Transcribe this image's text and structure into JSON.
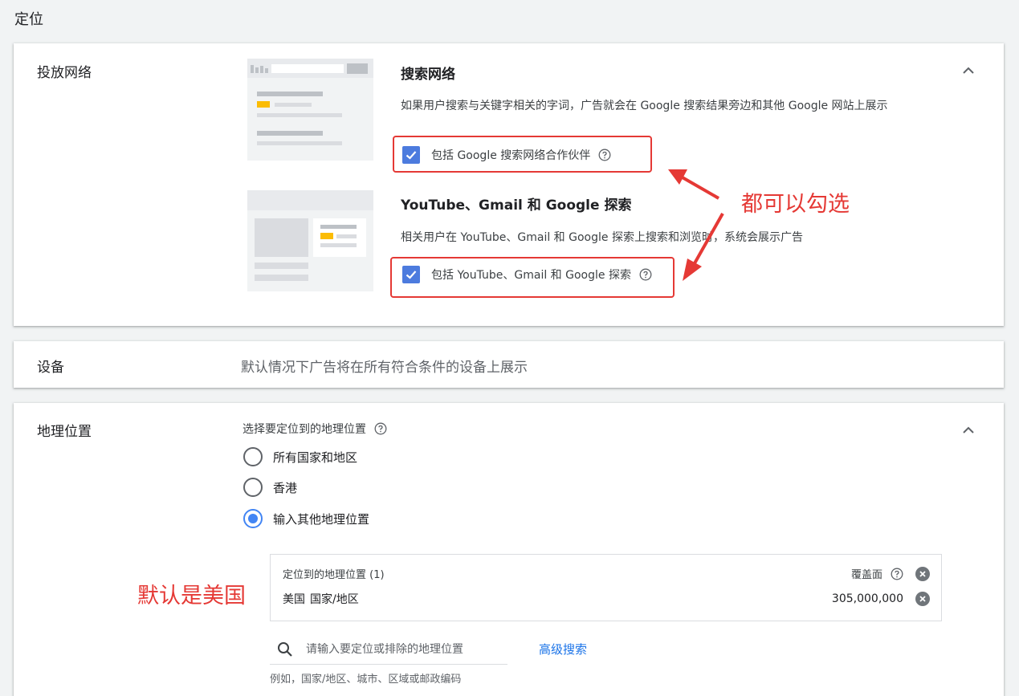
{
  "page": {
    "title": "定位"
  },
  "network": {
    "label": "投放网络",
    "search": {
      "title": "搜索网络",
      "description": "如果用户搜索与关键字相关的字词，广告就会在 Google 搜索结果旁边和其他 Google 网站上展示",
      "checkbox_label": "包括 Google 搜索网络合作伙伴",
      "checked": true
    },
    "display": {
      "title": "YouTube、Gmail 和 Google 探索",
      "description": "相关用户在 YouTube、Gmail 和 Google 探索上搜索和浏览时，系统会展示广告",
      "checkbox_label": "包括 YouTube、Gmail 和 Google 探索",
      "checked": true
    }
  },
  "annotations": {
    "both_checkable": "都可以勾选",
    "default_us": "默认是美国"
  },
  "device": {
    "label": "设备",
    "description": "默认情况下广告将在所有符合条件的设备上展示"
  },
  "geo": {
    "label": "地理位置",
    "heading": "选择要定位到的地理位置",
    "options": [
      {
        "label": "所有国家和地区",
        "selected": false
      },
      {
        "label": "香港",
        "selected": false
      },
      {
        "label": "输入其他地理位置",
        "selected": true
      }
    ],
    "targets": {
      "header": "定位到的地理位置 (1)",
      "reach_label": "覆盖面",
      "rows": [
        {
          "name": "美国",
          "type": "国家/地区",
          "reach": "305,000,000"
        }
      ]
    },
    "search": {
      "placeholder": "请输入要定位或排除的地理位置",
      "advanced_label": "高级搜索",
      "hint": "例如，国家/地区、城市、区域或邮政编码"
    }
  },
  "colors": {
    "accent_blue": "#4285f4",
    "checkbox_blue": "#4c7bde",
    "annotation_red": "#e53935",
    "link_blue": "#1a73e8"
  }
}
